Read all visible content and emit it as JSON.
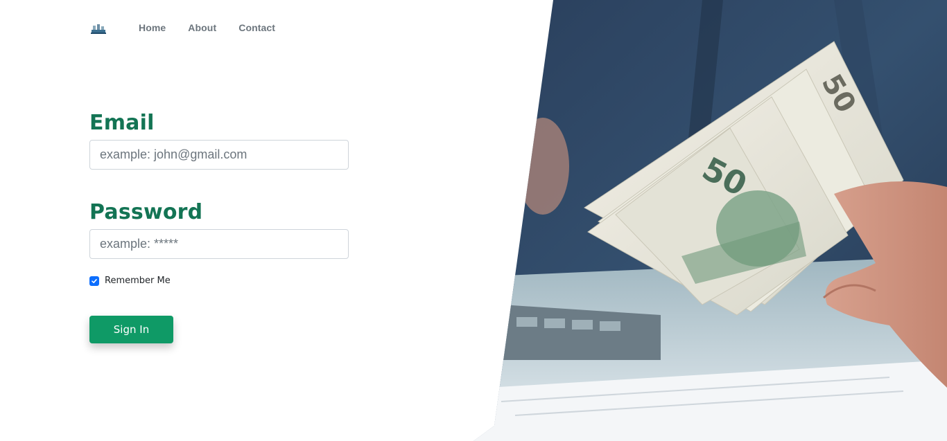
{
  "nav": {
    "logo_icon": "bank-logo-icon",
    "links": [
      {
        "label": "Home"
      },
      {
        "label": "About"
      },
      {
        "label": "Contact"
      }
    ]
  },
  "form": {
    "email_label": "Email",
    "email_placeholder": "example: john@gmail.com",
    "password_label": "Password",
    "password_placeholder": "example: *****",
    "remember_label": "Remember Me",
    "remember_checked": true,
    "submit_label": "Sign In"
  },
  "hero": {
    "image_subject": "hand-holding-fifty-dollar-bills-photo"
  },
  "colors": {
    "heading": "#137454",
    "button": "#0f9a66",
    "checkbox": "#0d6efd",
    "nav_link": "#6c757d"
  }
}
